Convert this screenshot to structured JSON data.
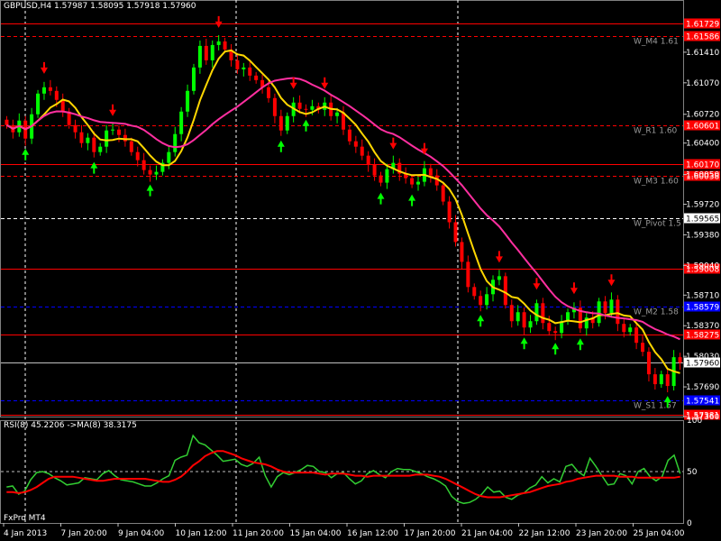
{
  "header": {
    "symbol": "GBPUSD,H4",
    "ohlc": "1.57987 1.58095 1.57918 1.57960"
  },
  "rsi_header": {
    "label": "RSI(8) 45.2206",
    "ma_label": "->MA(8) 38.3175"
  },
  "brand": "FxPro MT4",
  "colors": {
    "bull": "#00ff00",
    "bear": "#ff0000",
    "ma_fast": "#ffd700",
    "ma_slow": "#ff2fa0",
    "rsi": "#32cd32",
    "rsi_ma": "#ff0000",
    "level_line": "#ff0000",
    "blue_line": "#0000ff",
    "current_price": "#c0c0c0",
    "arrow_up": "#00ff00",
    "arrow_down": "#ff0000"
  },
  "chart_data": [
    {
      "type": "candlestick",
      "title": "GBPUSD,H4",
      "ylim": [
        1.5736,
        1.6185
      ],
      "price_ticks": [
        "1.61410",
        "1.61070",
        "1.60720",
        "1.60400",
        "1.60050",
        "1.59720",
        "1.59380",
        "1.59040",
        "1.58710",
        "1.58370",
        "1.58030",
        "1.57690",
        "1.57360"
      ],
      "x_labels": [
        "4 Jan 2013",
        "7 Jan 20:00",
        "9 Jan 04:00",
        "10 Jan 12:00",
        "11 Jan 20:00",
        "15 Jan 04:00",
        "16 Jan 12:00",
        "17 Jan 20:00",
        "21 Jan 04:00",
        "22 Jan 12:00",
        "23 Jan 20:00",
        "25 Jan 04:00"
      ],
      "levels": [
        {
          "name": "",
          "price": 1.61729,
          "tag": "1.61729",
          "style": "solid",
          "color": "#ff0000",
          "tag_bg": "#ff0000"
        },
        {
          "name": "W_M4 1.61",
          "price": 1.61586,
          "tag": "1.61586",
          "style": "dashed",
          "color": "#ff0000",
          "tag_bg": "#ff0000"
        },
        {
          "name": "W_R1 1.60",
          "price": 1.60601,
          "tag": "1.60601",
          "style": "dashed",
          "color": "#ff0000",
          "tag_bg": "#ff0000"
        },
        {
          "name": "",
          "price": 1.6017,
          "tag": "1.60170",
          "style": "solid",
          "color": "#ff0000",
          "tag_bg": "#ff0000"
        },
        {
          "name": "W_M3 1.60",
          "price": 1.60038,
          "tag": "1.60038",
          "style": "dashed",
          "color": "#ff0000",
          "tag_bg": "#ff0000"
        },
        {
          "name": "W_Pivot 1.5",
          "price": 1.59565,
          "tag": "1.59565",
          "style": "dashed",
          "color": "#ffffff",
          "tag_bg": "#ffffff"
        },
        {
          "name": "",
          "price": 1.59008,
          "tag": "1.59008",
          "style": "solid",
          "color": "#ff0000",
          "tag_bg": "#ff0000"
        },
        {
          "name": "W_M2 1.58",
          "price": 1.58579,
          "tag": "1.58579",
          "style": "dashed",
          "color": "#0000ff",
          "tag_bg": "#0000ff"
        },
        {
          "name": "",
          "price": 1.58275,
          "tag": "1.58275",
          "style": "solid",
          "color": "#ff0000",
          "tag_bg": "#ff0000"
        },
        {
          "name": "",
          "price": 1.5796,
          "tag": "1.57960",
          "style": "solid",
          "color": "#c0c0c0",
          "tag_bg": "#ffffff"
        },
        {
          "name": "W_S1 1.57",
          "price": 1.57541,
          "tag": "1.57541",
          "style": "dashed",
          "color": "#0000ff",
          "tag_bg": "#0000ff"
        },
        {
          "name": "",
          "price": 1.57381,
          "tag": "1.57381",
          "style": "solid",
          "color": "#ff0000",
          "tag_bg": "#ff0000"
        }
      ],
      "close": [
        1.606,
        1.6052,
        1.6065,
        1.6045,
        1.6072,
        1.6095,
        1.6102,
        1.6098,
        1.6088,
        1.6075,
        1.606,
        1.6052,
        1.604,
        1.6046,
        1.603,
        1.6036,
        1.6054,
        1.6055,
        1.6049,
        1.6042,
        1.603,
        1.6021,
        1.601,
        1.6005,
        1.6008,
        1.6018,
        1.603,
        1.605,
        1.6075,
        1.6098,
        1.6124,
        1.6148,
        1.6132,
        1.6149,
        1.6153,
        1.6144,
        1.6132,
        1.6122,
        1.6124,
        1.6115,
        1.611,
        1.6102,
        1.609,
        1.607,
        1.6054,
        1.607,
        1.6085,
        1.6078,
        1.6077,
        1.6081,
        1.6077,
        1.6085,
        1.607,
        1.6074,
        1.6055,
        1.6042,
        1.6036,
        1.6026,
        1.6016,
        1.6004,
        1.5996,
        1.6011,
        1.6018,
        1.6006,
        1.6001,
        1.5994,
        1.5997,
        1.6012,
        1.6004,
        1.5993,
        1.5975,
        1.5952,
        1.593,
        1.5908,
        1.588,
        1.587,
        1.586,
        1.5872,
        1.5888,
        1.5892,
        1.586,
        1.5842,
        1.5852,
        1.5835,
        1.5842,
        1.5862,
        1.584,
        1.5831,
        1.5829,
        1.5842,
        1.5852,
        1.5857,
        1.5834,
        1.5846,
        1.584,
        1.5864,
        1.5851,
        1.5866,
        1.5839,
        1.583,
        1.5835,
        1.5818,
        1.5808,
        1.5783,
        1.5772,
        1.5783,
        1.577,
        1.5802,
        1.5796
      ],
      "series": [
        {
          "name": "",
          "values": []
        },
        {
          "name": "",
          "values": []
        }
      ]
    },
    {
      "type": "line",
      "title": "RSI(8) 45.2206 ->MA(8) 38.3175",
      "ylim": [
        0,
        100
      ],
      "y_ticks": [
        "100",
        "50",
        "0"
      ],
      "series": [
        {
          "name": "RSI(8)",
          "values": [
            35,
            36,
            28,
            31,
            42,
            49,
            50,
            48,
            44,
            41,
            37,
            38,
            39,
            44,
            43,
            42,
            48,
            51,
            46,
            42,
            41,
            40,
            38,
            36,
            36,
            39,
            43,
            46,
            61,
            64,
            66,
            85,
            78,
            76,
            71,
            66,
            60,
            61,
            62,
            57,
            55,
            58,
            64,
            46,
            35,
            45,
            49,
            47,
            49,
            52,
            56,
            55,
            50,
            49,
            44,
            48,
            49,
            43,
            38,
            41,
            48,
            51,
            47,
            44,
            50,
            53,
            52,
            52,
            50,
            48,
            45,
            43,
            40,
            36,
            26,
            21,
            19,
            20,
            23,
            28,
            35,
            30,
            31,
            25,
            23,
            27,
            29,
            34,
            37,
            45,
            39,
            43,
            40,
            55,
            57,
            50,
            46,
            63,
            55,
            46,
            37,
            38,
            48,
            46,
            38,
            50,
            53,
            45,
            41,
            45,
            61,
            66,
            48
          ]
        },
        {
          "name": "MA(8)",
          "values": [
            30,
            30,
            29,
            30,
            32,
            35,
            39,
            43,
            45,
            45,
            45,
            45,
            44,
            43,
            42,
            41,
            41,
            42,
            43,
            43,
            43,
            43,
            43,
            43,
            42,
            41,
            40,
            40,
            42,
            45,
            50,
            56,
            60,
            65,
            68,
            70,
            70,
            68,
            66,
            63,
            61,
            59,
            58,
            57,
            55,
            52,
            50,
            49,
            49,
            49,
            49,
            49,
            48,
            47,
            48,
            48,
            48,
            47,
            46,
            46,
            45,
            46,
            46,
            46,
            46,
            46,
            46,
            46,
            47,
            47,
            47,
            46,
            45,
            43,
            40,
            37,
            34,
            31,
            28,
            26,
            25,
            25,
            25,
            26,
            27,
            28,
            29,
            30,
            32,
            34,
            36,
            37,
            38,
            40,
            41,
            43,
            44,
            45,
            46,
            46,
            46,
            46,
            45,
            45,
            45,
            44,
            44,
            44,
            44,
            44,
            44,
            44,
            45
          ]
        }
      ]
    }
  ]
}
